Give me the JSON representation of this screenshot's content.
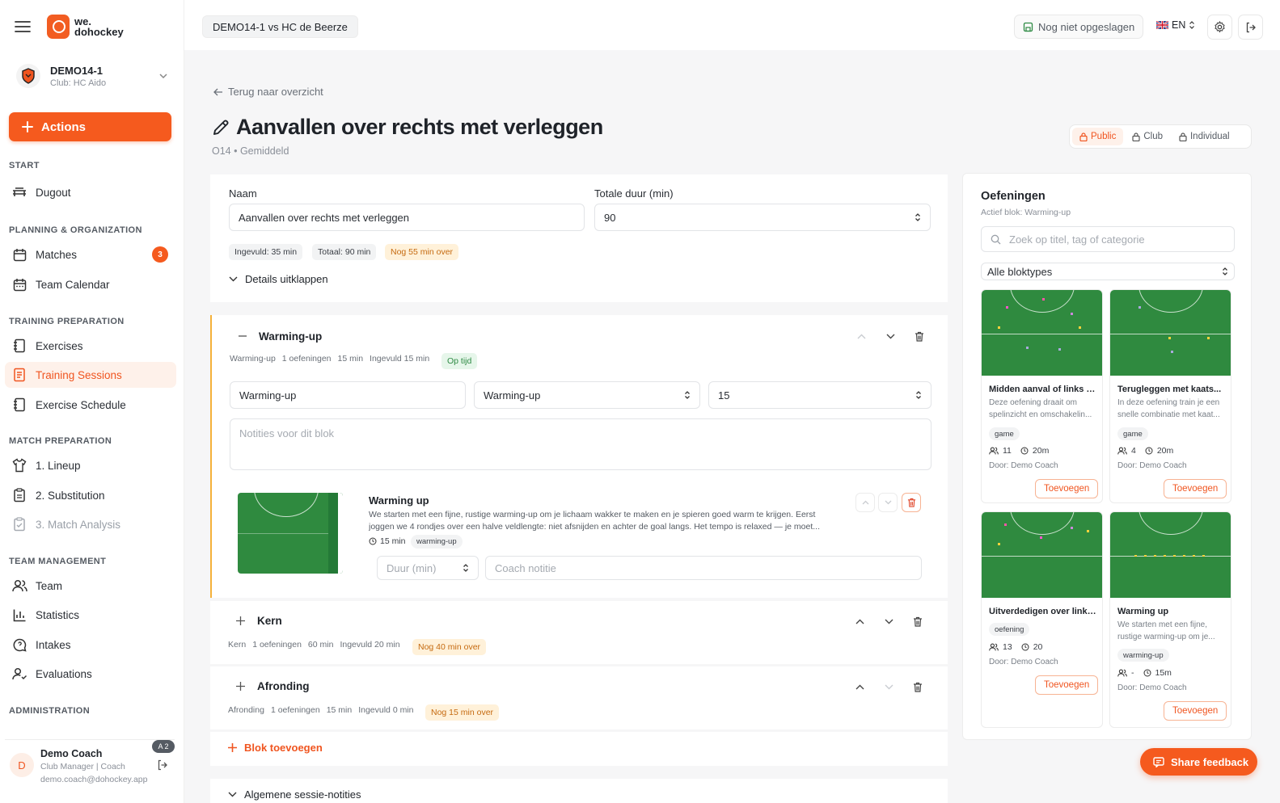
{
  "brand": {
    "name_line1": "we.",
    "name_line2": "dohockey"
  },
  "team": {
    "name": "DEMO14-1",
    "club": "Club: HC Aido"
  },
  "actions_label": "Actions",
  "sections": {
    "start": "START",
    "planning": "PLANNING & ORGANIZATION",
    "training": "TRAINING PREPARATION",
    "match": "MATCH PREPARATION",
    "team_mgmt": "TEAM MANAGEMENT",
    "admin": "ADMINISTRATION"
  },
  "nav": {
    "dugout": "Dugout",
    "matches": "Matches",
    "matches_badge": "3",
    "team_calendar": "Team Calendar",
    "exercises": "Exercises",
    "training_sessions": "Training Sessions",
    "exercise_schedule": "Exercise Schedule",
    "lineup": "1. Lineup",
    "substitution": "2. Substitution",
    "match_analysis": "3. Match Analysis",
    "team": "Team",
    "statistics": "Statistics",
    "intakes": "Intakes",
    "evaluations": "Evaluations"
  },
  "user": {
    "initial": "D",
    "name": "Demo Coach",
    "role": "Club Manager | Coach",
    "email": "demo.coach@dohockey.app",
    "pill": "A 2"
  },
  "topbar": {
    "match": "DEMO14-1 vs HC de Beerze",
    "save_status": "Nog niet opgeslagen",
    "language": "EN"
  },
  "page": {
    "back": "Terug naar overzicht",
    "title": "Aanvallen over rechts met verleggen",
    "subtitle": "O14 • Gemiddeld",
    "visibility": {
      "public": "Public",
      "club": "Club",
      "individual": "Individual"
    }
  },
  "form": {
    "name_label": "Naam",
    "name_value": "Aanvallen over rechts met verleggen",
    "duration_label": "Totale duur (min)",
    "duration_value": "90",
    "chips": {
      "filled": "Ingevuld: 35 min",
      "total": "Totaal: 90 min",
      "remaining": "Nog 55 min over"
    },
    "details": "Details uitklappen"
  },
  "blocks": {
    "warmup": {
      "title": "Warming-up",
      "meta": [
        "Warming-up",
        "1 oefeningen",
        "15 min",
        "Ingevuld 15 min"
      ],
      "status": "Op tijd",
      "name_value": "Warming-up",
      "type_value": "Warming-up",
      "minutes_value": "15",
      "notes_placeholder": "Notities voor dit blok",
      "exercise": {
        "title": "Warming up",
        "desc": "We starten met een fijne, rustige warming-up om je lichaam wakker te maken en je spieren goed warm te krijgen. Eerst joggen we 4 rondjes over een halve veldlengte: niet afsnijden en achter de goal langs. Het tempo is relaxed — je moet...",
        "duration": "15 min",
        "tag": "warming-up",
        "duration_placeholder": "Duur (min)",
        "note_placeholder": "Coach notitie"
      }
    },
    "kern": {
      "title": "Kern",
      "meta": [
        "Kern",
        "1 oefeningen",
        "60 min",
        "Ingevuld 20 min"
      ],
      "status": "Nog 40 min over"
    },
    "afronding": {
      "title": "Afronding",
      "meta": [
        "Afronding",
        "1 oefeningen",
        "15 min",
        "Ingevuld 0 min"
      ],
      "status": "Nog 15 min over"
    },
    "add_block": "Blok toevoegen",
    "general_notes": "Algemene sessie-notities"
  },
  "library": {
    "title": "Oefeningen",
    "active": "Actief blok: Warming-up",
    "search_placeholder": "Zoek op titel, tag of categorie",
    "filter_value": "Alle bloktypes",
    "add_label": "Toevoegen",
    "cards": [
      {
        "title": "Midden aanval of links of...",
        "desc": "Deze oefening draait om spelinzicht en omschakelin...",
        "tag": "game",
        "players": "11",
        "time": "20m",
        "by": "Door: Demo Coach"
      },
      {
        "title": "Terugleggen met kaats...",
        "desc": "In deze oefening train je een snelle combinatie met kaat...",
        "tag": "game",
        "players": "4",
        "time": "20m",
        "by": "Door: Demo Coach"
      },
      {
        "title": "Uitverdedigen over links...",
        "desc": "",
        "tag": "oefening",
        "players": "13",
        "time": "20",
        "by": "Door: Demo Coach"
      },
      {
        "title": "Warming up",
        "desc": "We starten met een fijne, rustige warming-up om je...",
        "tag": "warming-up",
        "players": "-",
        "time": "15m",
        "by": "Door: Demo Coach"
      }
    ]
  },
  "feedback": "Share feedback",
  "colors": {
    "accent": "#f55a1e",
    "pitch": "#2f8a3f",
    "warn_bg": "#fff1d9",
    "ok_bg": "#e6f6ea"
  }
}
